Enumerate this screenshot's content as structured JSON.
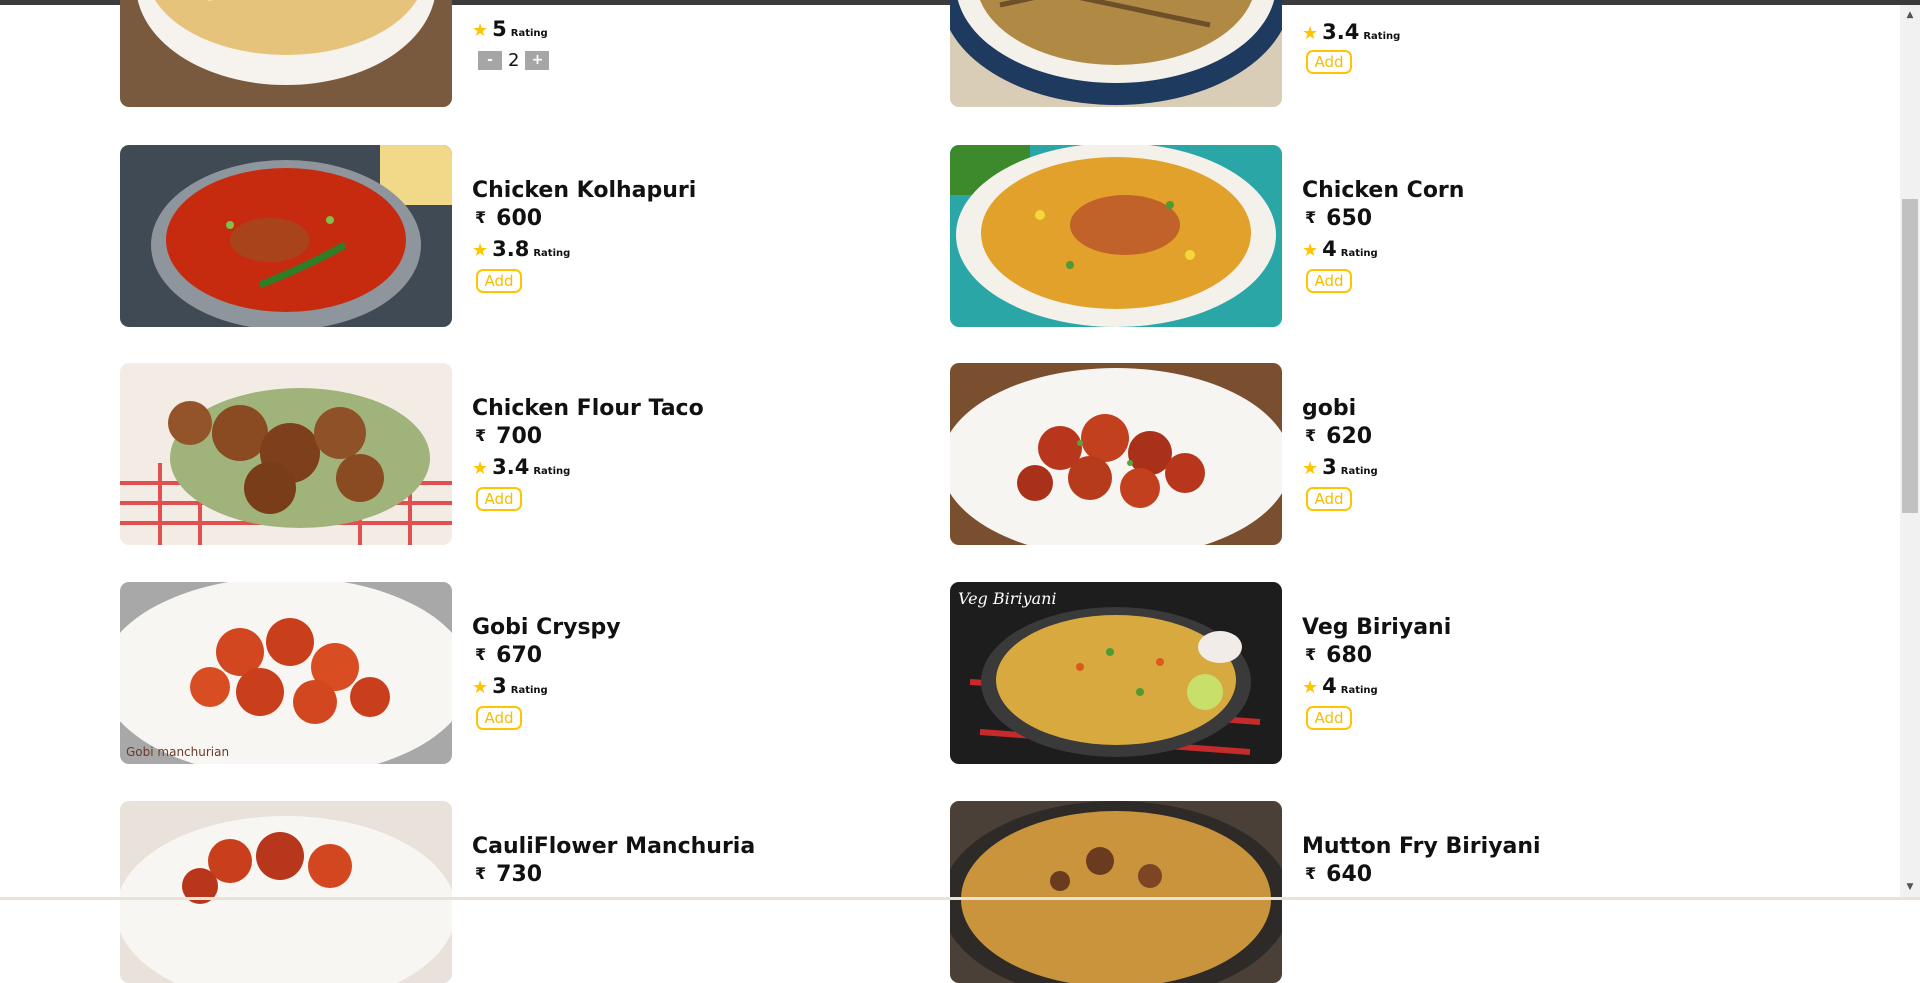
{
  "currency_symbol": "₹",
  "rating_label": "Rating",
  "add_label": "Add",
  "accent_color": "#ffc400",
  "icons": {
    "star": "star-icon",
    "rupee": "rupee-icon",
    "minus": "minus-icon",
    "plus": "plus-icon"
  },
  "stepper": {
    "minus_label": "-",
    "plus_label": "+",
    "quantity": "2"
  },
  "partial_items": [
    {
      "name": "",
      "price": "",
      "rating": "5"
    },
    {
      "name": "",
      "price": "",
      "rating": "3.4"
    }
  ],
  "items": [
    {
      "name": "Chicken Kolhapuri",
      "price": "600",
      "rating": "3.8"
    },
    {
      "name": "Chicken Corn",
      "price": "650",
      "rating": "4"
    },
    {
      "name": "Chicken Flour Taco",
      "price": "700",
      "rating": "3.4"
    },
    {
      "name": "gobi",
      "price": "620",
      "rating": "3"
    },
    {
      "name": "Gobi Cryspy",
      "price": "670",
      "rating": "3"
    },
    {
      "name": "Veg Biriyani",
      "price": "680",
      "rating": "4"
    },
    {
      "name": "CauliFlower Manchuria",
      "price": "730",
      "rating": ""
    },
    {
      "name": "Mutton Fry Biriyani",
      "price": "640",
      "rating": ""
    }
  ],
  "image_captions": {
    "veg_biriyani": "Veg Biriyani",
    "gobi_cryspy": "Gobi manchurian"
  }
}
